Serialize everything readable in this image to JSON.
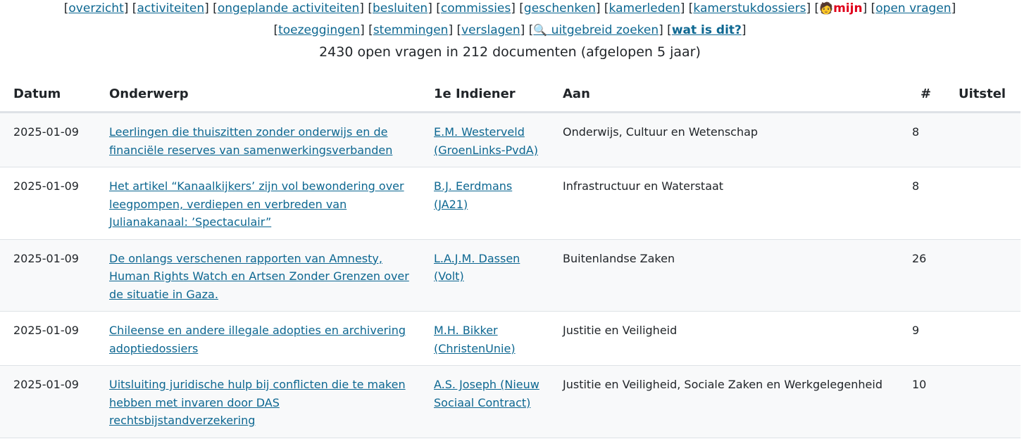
{
  "nav": {
    "row1": [
      {
        "label": "overzicht"
      },
      {
        "label": "activiteiten"
      },
      {
        "label": "ongeplande activiteiten"
      },
      {
        "label": "besluiten"
      },
      {
        "label": "commissies"
      },
      {
        "label": "geschenken"
      },
      {
        "label": "kamerleden"
      },
      {
        "label": "kamerstukdossiers"
      },
      {
        "label": "mijn",
        "emoji": "🧑"
      },
      {
        "label": "open vragen"
      }
    ],
    "row2": [
      {
        "label": "toezeggingen"
      },
      {
        "label": "stemmingen"
      },
      {
        "label": "verslagen"
      },
      {
        "label": "uitgebreid zoeken",
        "emoji": "🔍"
      },
      {
        "label": "wat is dit?"
      }
    ]
  },
  "summary": "2430 open vragen in 212 documenten (afgelopen 5 jaar)",
  "table": {
    "headers": {
      "datum": "Datum",
      "onderwerp": "Onderwerp",
      "indiener": "1e Indiener",
      "aan": "Aan",
      "num": "#",
      "uitstel": "Uitstel"
    },
    "rows": [
      {
        "datum": "2025-01-09",
        "onderwerp": "Leerlingen die thuiszitten zonder onderwijs en de financiële reserves van samenwerkingsverbanden",
        "indiener": "E.M. Westerveld (GroenLinks-PvdA)",
        "aan": "Onderwijs, Cultuur en Wetenschap",
        "num": "8",
        "uitstel": ""
      },
      {
        "datum": "2025-01-09",
        "onderwerp": "Het artikel “Kanaalkijkers’ zijn vol bewondering over leegpompen, verdiepen en verbreden van Julianakanaal: ’Spectaculair”",
        "indiener": "B.J. Eerdmans (JA21)",
        "aan": "Infrastructuur en Waterstaat",
        "num": "8",
        "uitstel": ""
      },
      {
        "datum": "2025-01-09",
        "onderwerp": "De onlangs verschenen rapporten van Amnesty, Human Rights Watch en Artsen Zonder Grenzen over de situatie in Gaza.",
        "indiener": "L.A.J.M. Dassen (Volt)",
        "aan": "Buitenlandse Zaken",
        "num": "26",
        "uitstel": ""
      },
      {
        "datum": "2025-01-09",
        "onderwerp": "Chileense en andere illegale adopties en archivering adoptiedossiers",
        "indiener": "M.H. Bikker (ChristenUnie)",
        "aan": "Justitie en Veiligheid",
        "num": "9",
        "uitstel": ""
      },
      {
        "datum": "2025-01-09",
        "onderwerp": "Uitsluiting juridische hulp bij conflicten die te maken hebben met invaren door DAS rechtsbijstandverzekering",
        "indiener": "A.S. Joseph (Nieuw Sociaal Contract)",
        "aan": "Justitie en Veiligheid, Sociale Zaken en Werkgelegenheid",
        "num": "10",
        "uitstel": ""
      }
    ]
  }
}
